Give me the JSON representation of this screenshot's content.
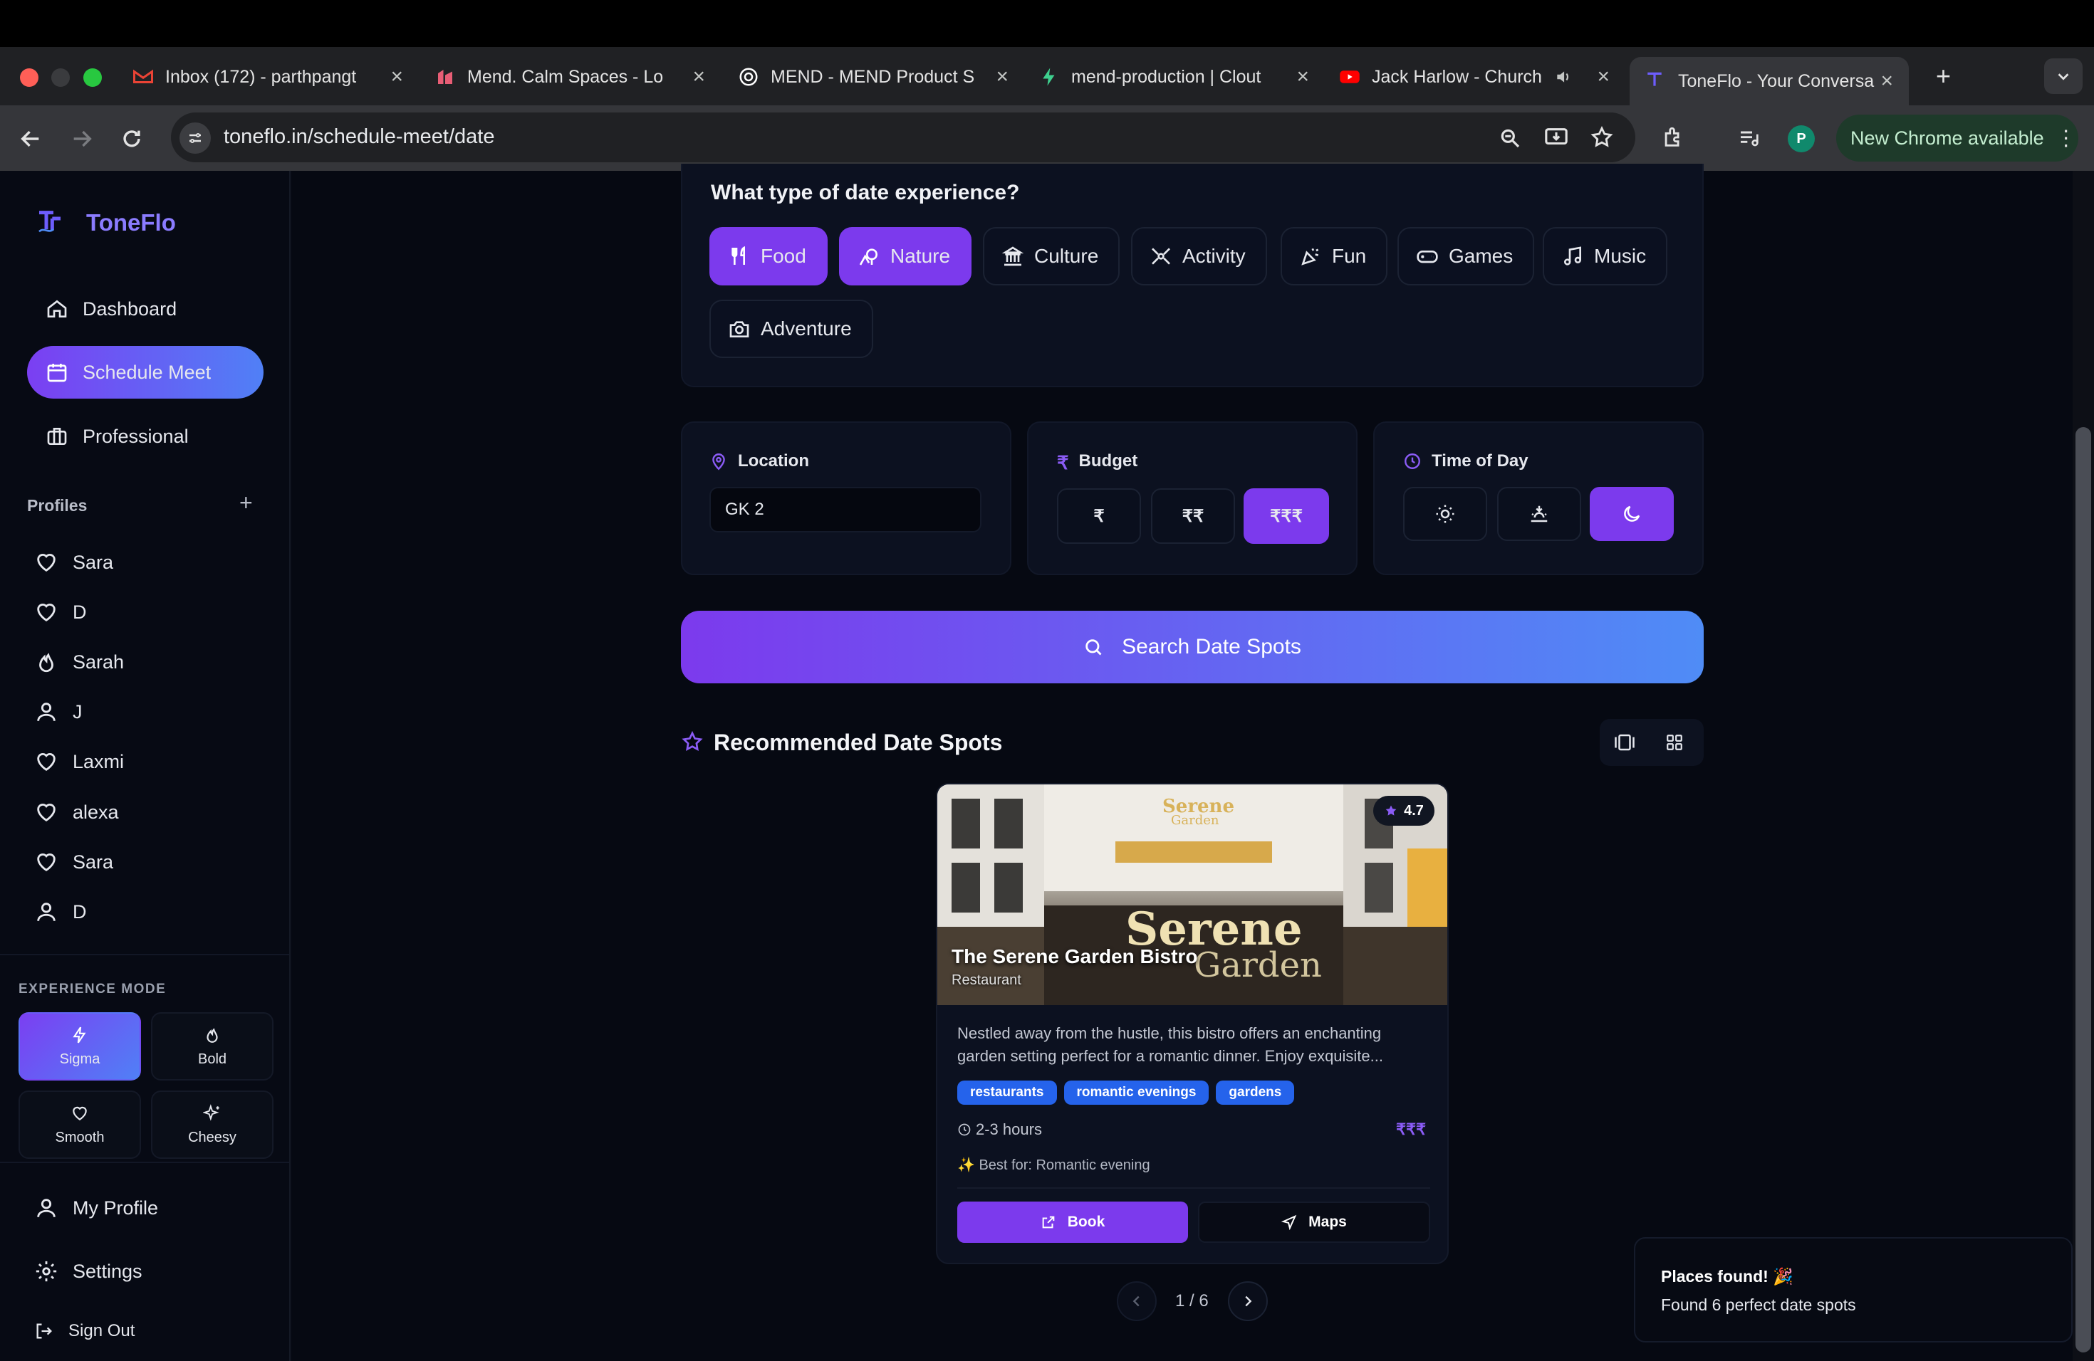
{
  "browser": {
    "tabs": [
      {
        "title": "Inbox (172) - parthpangt",
        "favicon": "gmail-icon",
        "color": "#ea4335"
      },
      {
        "title": "Mend. Calm Spaces - Lo",
        "favicon": "mend-icon",
        "color": "#e85d75"
      },
      {
        "title": "MEND - MEND Product S",
        "favicon": "openai-icon",
        "color": "#ffffff"
      },
      {
        "title": "mend-production | Clout",
        "favicon": "bolt-icon",
        "color": "#3ecf8e"
      },
      {
        "title": "Jack Harlow - Church",
        "favicon": "youtube-icon",
        "color": "#ff0000"
      },
      {
        "title": "ToneFlo - Your Conversa",
        "favicon": "toneflo-icon",
        "color": "#6d5dfc"
      }
    ],
    "url": "toneflo.in/schedule-meet/date",
    "new_chrome": "New Chrome available",
    "avatar_letter": "P"
  },
  "sidebar": {
    "brand": "ToneFlo",
    "nav": [
      {
        "label": "Dashboard",
        "icon": "home-icon"
      },
      {
        "label": "Schedule Meet",
        "icon": "calendar-icon"
      },
      {
        "label": "Professional",
        "icon": "briefcase-icon"
      }
    ],
    "profiles_label": "Profiles",
    "add_symbol": "+",
    "profiles": [
      {
        "name": "Sara",
        "icon": "heart-icon"
      },
      {
        "name": "D",
        "icon": "heart-icon"
      },
      {
        "name": "Sarah",
        "icon": "flame-icon"
      },
      {
        "name": "J",
        "icon": "user-icon"
      },
      {
        "name": "Laxmi",
        "icon": "heart-icon"
      },
      {
        "name": "alexa",
        "icon": "heart-icon"
      },
      {
        "name": "Sara",
        "icon": "heart-icon"
      },
      {
        "name": "D",
        "icon": "user-icon"
      }
    ],
    "experience_label": "EXPERIENCE MODE",
    "modes": [
      {
        "label": "Sigma",
        "icon": "bolt-icon"
      },
      {
        "label": "Bold",
        "icon": "flame-icon"
      },
      {
        "label": "Smooth",
        "icon": "heart-icon"
      },
      {
        "label": "Cheesy",
        "icon": "sparkles-icon"
      }
    ],
    "my_profile": "My Profile",
    "settings": "Settings",
    "sign_out": "Sign Out"
  },
  "main": {
    "question": "What type of date experience?",
    "categories": [
      {
        "label": "Food",
        "icon": "utensils-icon",
        "selected": true
      },
      {
        "label": "Nature",
        "icon": "trees-icon",
        "selected": true
      },
      {
        "label": "Culture",
        "icon": "landmark-icon",
        "selected": false
      },
      {
        "label": "Activity",
        "icon": "activity-icon",
        "selected": false
      },
      {
        "label": "Fun",
        "icon": "party-icon",
        "selected": false
      },
      {
        "label": "Games",
        "icon": "gamepad-icon",
        "selected": false
      },
      {
        "label": "Music",
        "icon": "music-icon",
        "selected": false
      },
      {
        "label": "Adventure",
        "icon": "camera-icon",
        "selected": false
      }
    ],
    "location": {
      "label": "Location",
      "value": "GK 2"
    },
    "budget": {
      "label": "Budget",
      "icon": "rupee-icon",
      "options": [
        "₹",
        "₹₹",
        "₹₹₹"
      ],
      "selected": "₹₹₹"
    },
    "time": {
      "label": "Time of Day",
      "options": [
        "sun-icon",
        "sunset-icon",
        "moon-icon"
      ],
      "selected": "moon-icon"
    },
    "search_label": "Search Date Spots",
    "recommended_title": "Recommended Date Spots",
    "card": {
      "rating": "4.7",
      "sign_text_top": "Serene",
      "sign_text_bottom": "Garden",
      "name": "The Serene Garden Bistro",
      "type": "Restaurant",
      "description_line1": "Nestled away from the hustle, this bistro offers an enchanting",
      "description_line2": "garden setting perfect for a romantic dinner. Enjoy exquisite...",
      "tags": [
        "restaurants",
        "romantic evenings",
        "gardens"
      ],
      "duration": "2-3 hours",
      "price": "₹₹₹",
      "best_for": "✨ Best for: Romantic evening",
      "book_label": "Book",
      "maps_label": "Maps"
    },
    "pagination": "1 / 6",
    "toast": {
      "title": "Places found! 🎉",
      "body": "Found 6 perfect date spots"
    }
  },
  "colors": {
    "accent": "#7c3aed",
    "accent_blue": "#4f8cf6",
    "bg": "#060912"
  }
}
